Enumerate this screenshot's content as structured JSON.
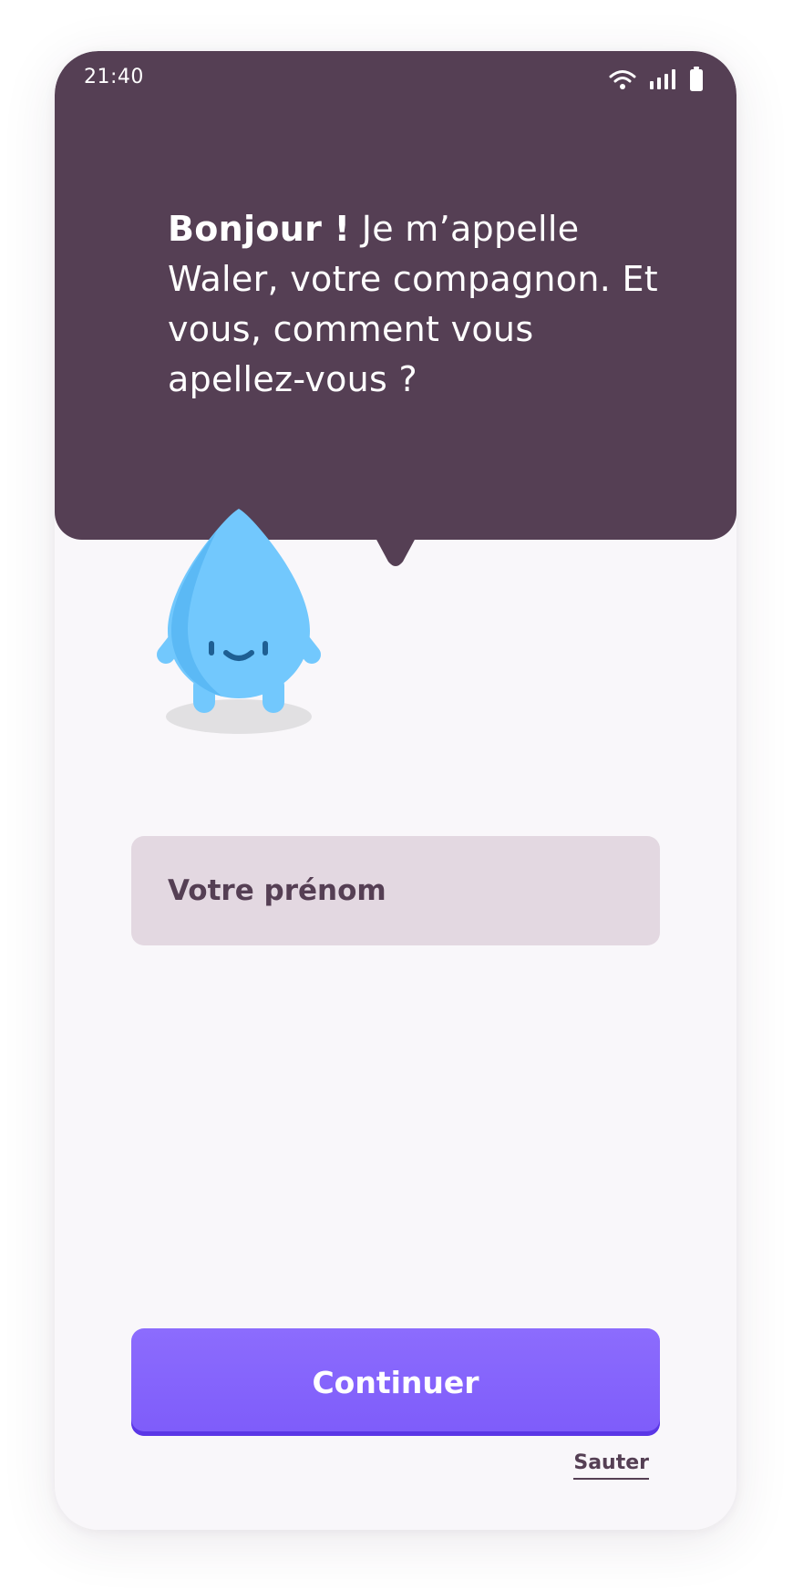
{
  "status_bar": {
    "time": "21:40",
    "icons": [
      "wifi-icon",
      "signal-icon",
      "battery-icon"
    ]
  },
  "greeting": {
    "bold": "Bonjour !",
    "text": " Je m’appelle Waler, votre compagnon. Et vous, comment vous apellez-vous ?"
  },
  "mascot": {
    "icon": "water-drop-mascot-icon"
  },
  "name_input": {
    "placeholder": "Votre prénom",
    "value": ""
  },
  "actions": {
    "continue_label": "Continuer",
    "skip_label": "Sauter"
  },
  "colors": {
    "header_bg": "#553f54",
    "page_bg": "#f9f7fa",
    "input_bg": "#e3d8e1",
    "primary": "#8163fb",
    "mascot": "#72c8fd"
  }
}
